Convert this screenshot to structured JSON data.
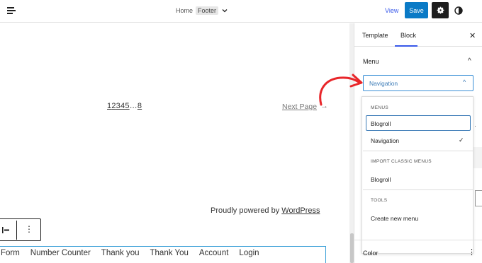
{
  "topbar": {
    "breadcrumb_home": "Home",
    "breadcrumb_current": "Footer",
    "view_label": "View",
    "save_label": "Save"
  },
  "canvas": {
    "pagination_pages": [
      "1",
      "2",
      "3",
      "4",
      "5",
      "…",
      "8"
    ],
    "next_page": "Next Page",
    "next_arrow": "→",
    "powered_prefix": "Proudly powered by ",
    "powered_link": "WordPress",
    "nav_items": [
      "y Form",
      "Number Counter",
      "Thank you",
      "Thank You",
      "Account",
      "Login"
    ]
  },
  "sidebar": {
    "tab_template": "Template",
    "tab_block": "Block",
    "menu_header": "Menu",
    "selected_menu": "Navigation",
    "dropdown": {
      "menus_label": "MENUS",
      "menus": [
        "Blogroll",
        "Navigation"
      ],
      "import_label": "IMPORT CLASSIC MENUS",
      "import_items": [
        "Blogroll"
      ],
      "tools_label": "TOOLS",
      "tools_items": [
        "Create new menu"
      ]
    },
    "color_header": "Color"
  },
  "colors": {
    "accent": "#3858e9",
    "save_blue": "#0a7ac6",
    "annotation_red": "#e8262a",
    "nav_block_border": "#3aa0d8"
  }
}
